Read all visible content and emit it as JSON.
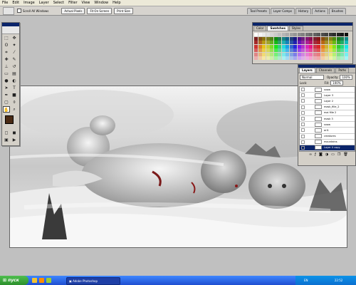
{
  "menu": {
    "items": [
      "File",
      "Edit",
      "Image",
      "Layer",
      "Select",
      "Filter",
      "View",
      "Window",
      "Help"
    ]
  },
  "options": {
    "scroll_all_windows_label": "Scroll All Windows",
    "actual_pixels": "Actual Pixels",
    "fit_on_screen": "Fit On Screen",
    "print_size": "Print Size",
    "well_tabs": [
      "Tool Presets",
      "Layer Comps",
      "History",
      "Actions",
      "Brushes"
    ]
  },
  "swatches_panel": {
    "tabs": [
      "Color",
      "Swatches",
      "Styles"
    ],
    "active_tab": "Swatches"
  },
  "layers_panel": {
    "tabs": [
      "Layers",
      "Channels",
      "Paths"
    ],
    "active_tab": "Layers",
    "blend_mode": "Normal",
    "opacity_label": "Opacity:",
    "opacity_value": "100%",
    "lock_label": "Lock:",
    "fill_label": "Fill:",
    "fill_value": "100%",
    "layers": [
      "snow",
      "Layer 3",
      "Layer 2",
      "mask_fille_2",
      "mai fille 2",
      "mask 3",
      "snow",
      "ori1",
      "creatures",
      "mountains",
      "Layer 0 copy"
    ],
    "selected_index": 10
  },
  "taskbar": {
    "start_label": "пуск",
    "task_label": "Adobe Photoshop",
    "tray_text": "EN",
    "clock": "22:52"
  },
  "colors": {
    "title_blue": "#0a246a",
    "foreground": "#4a2a14",
    "background": "#ffffff",
    "taskbar_blue": "#245edb",
    "start_green": "#3aa83a"
  }
}
